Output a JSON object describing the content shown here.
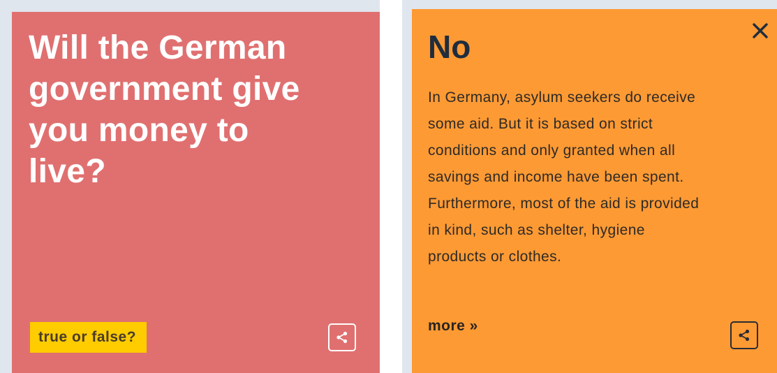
{
  "question_card": {
    "question": "Will the German government give you money to live?",
    "badge_label": "true or false?",
    "share_icon": "share-icon",
    "background_color": "#e07070"
  },
  "answer_card": {
    "title": "No",
    "body": "In Germany, asylum seekers do receive some aid. But it is based on strict conditions and only granted when all savings and income have been spent. Furthermore, most of the aid is provided in kind, such as shelter, hygiene products or clothes.",
    "more_label": "more »",
    "close_icon": "close-icon",
    "share_icon": "share-icon",
    "background_color": "#fd9a34"
  }
}
